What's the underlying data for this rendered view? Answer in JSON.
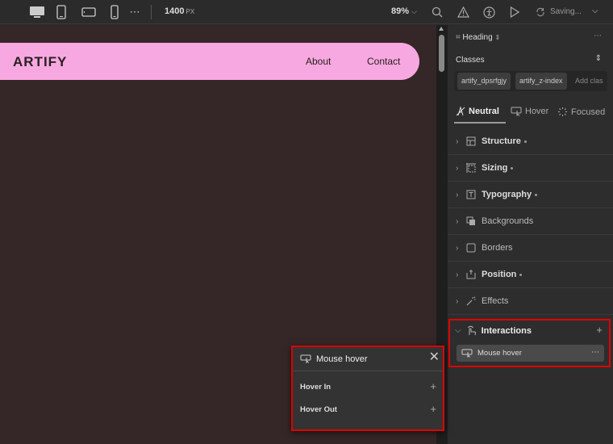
{
  "topbar": {
    "width_value": "1400",
    "width_unit": "PX",
    "zoom": "89%",
    "saving": "Saving..."
  },
  "canvas": {
    "logo": "ARTIFY",
    "nav": [
      "About",
      "Contact"
    ],
    "background": "#352727",
    "navbar_color": "#f8a8e0"
  },
  "panel": {
    "element": "Heading",
    "classes_label": "Classes",
    "classes": [
      "artify_dpsrfgjy",
      "artify_z-index"
    ],
    "add_class_placeholder": "Add clas",
    "states": [
      "Neutral",
      "Hover",
      "Focused"
    ],
    "sections": [
      {
        "label": "Structure",
        "dot": true
      },
      {
        "label": "Sizing",
        "dot": true
      },
      {
        "label": "Typography",
        "dot": true
      },
      {
        "label": "Backgrounds",
        "dot": false
      },
      {
        "label": "Borders",
        "dot": false
      },
      {
        "label": "Position",
        "dot": true
      },
      {
        "label": "Effects",
        "dot": false
      }
    ],
    "interactions": {
      "label": "Interactions",
      "item": "Mouse hover"
    }
  },
  "popup": {
    "title": "Mouse hover",
    "rows": [
      "Hover In",
      "Hover Out"
    ]
  }
}
